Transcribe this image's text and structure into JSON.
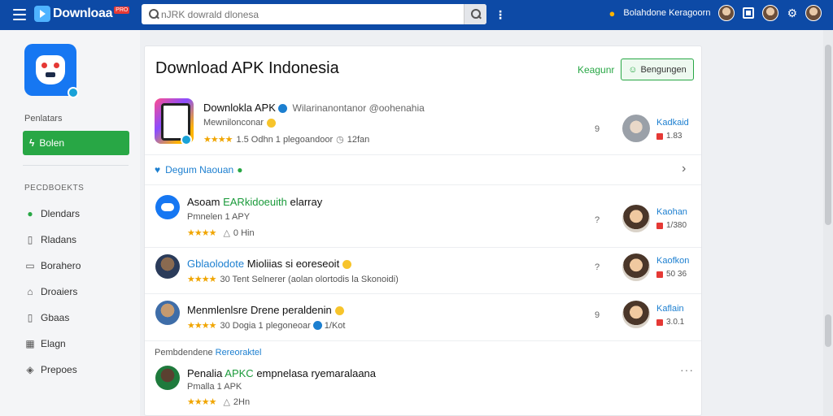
{
  "topbar": {
    "brand": "Downloaa",
    "brand_badge": "PRO",
    "search_placeholder": "nJRK dowrald dlonesa",
    "user_name": "Bolahdone Keragoorn"
  },
  "sidebar": {
    "label": "Penlatars",
    "green_button": "Bolen",
    "section_title": "PECDBOEKTS",
    "items": [
      {
        "label": "Dlendars",
        "icon": "check-circle-icon"
      },
      {
        "label": "Rladans",
        "icon": "bookmark-icon"
      },
      {
        "label": "Borahero",
        "icon": "grid-icon"
      },
      {
        "label": "Droaiers",
        "icon": "home-icon"
      },
      {
        "label": "Gbaas",
        "icon": "book-icon"
      },
      {
        "label": "Elagn",
        "icon": "table-icon"
      },
      {
        "label": "Prepoes",
        "icon": "shield-icon"
      }
    ]
  },
  "main": {
    "title": "Download APK Indonesia",
    "link": "Keagunr",
    "outline_button": "Bengungen",
    "featured": {
      "title": "Downlokla APK",
      "title_extra": "Wilarinanontanor @oohenahia",
      "sub": "Mewnilonconar",
      "meta": "1.5 Odhn 1 plegoandoor",
      "meta_extra": "12fan",
      "q": "9",
      "right_name": "Kadkaid",
      "right_stat": "1.83"
    },
    "banner": "Degum Naouan",
    "rows": [
      {
        "title_prefix": "Asoam",
        "title_accent": "EARkidoeuith",
        "title_suffix": "elarray",
        "sub": "Pmnelen 1 APY",
        "meta": "0 Hin",
        "q": "?",
        "right_name": "Kaohan",
        "right_stat": "1/380"
      },
      {
        "title_prefix": "",
        "title_accent": "Gblaolodote",
        "title_suffix": "Mioliias si eoreseoit",
        "sub": "",
        "meta": "30 Tent Selnerer (aolan olortodis la Skonoidi)",
        "q": "?",
        "right_name": "Kaofkon",
        "right_stat": "50 36"
      },
      {
        "title_prefix": "",
        "title_accent": "",
        "title_suffix": "Menmlenlsre Drene peraldenin",
        "sub": "",
        "meta": "30 Dogia 1 plegoneoar",
        "meta_extra": "1/Kot",
        "q": "9",
        "right_name": "Kaflain",
        "right_stat": "3.0.1"
      }
    ],
    "section_prefix": "Pembdendene",
    "section_accent": "Rereoraktel",
    "last_row": {
      "title_prefix": "Penalia",
      "title_accent": "APKC",
      "title_suffix": "empnelasa ryemaralaana",
      "sub": "Pmalla 1 APK",
      "meta": "2Hn"
    }
  }
}
